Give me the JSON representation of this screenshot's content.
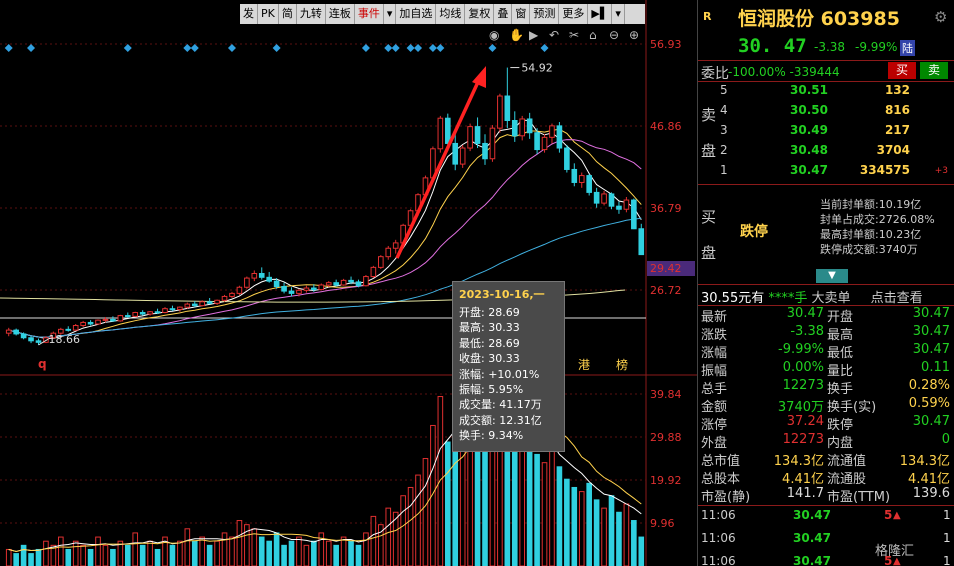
{
  "toolbar": {
    "items": [
      "发",
      "PK",
      "简",
      "九转",
      "连板",
      "事件",
      "▾",
      "加自选",
      "均线",
      "复权",
      "叠",
      "窗",
      "预测",
      "更多",
      "▶▌",
      "▾"
    ]
  },
  "chart": {
    "y_labels": [
      "56.93",
      "46.86",
      "36.79",
      "29.42",
      "26.72"
    ],
    "vol_labels": [
      "39.84",
      "29.88",
      "19.92",
      "9.96"
    ],
    "peak_label": "54.92",
    "low_label": "18.66",
    "marker_q": "q",
    "marker_gang": "港",
    "marker_bang": "榜",
    "colors": {
      "up": "#e03030",
      "down": "#30d0e0",
      "ma5": "#ffffff",
      "ma10": "#ffd24d",
      "ma20": "#e070e0",
      "ma60": "#40b0e0",
      "diamond": "#30a0e0"
    }
  },
  "chart_data": {
    "type": "candlestick",
    "yrange": [
      18,
      58
    ],
    "volume_range": [
      0,
      45
    ],
    "candles": [
      [
        20.2,
        20.9,
        19.8,
        20.6
      ],
      [
        20.6,
        20.8,
        19.9,
        20.1
      ],
      [
        20.1,
        20.3,
        19.4,
        19.6
      ],
      [
        19.6,
        19.8,
        18.9,
        19.2
      ],
      [
        19.2,
        19.5,
        18.66,
        19.0
      ],
      [
        19.0,
        19.8,
        18.9,
        19.6
      ],
      [
        19.6,
        20.4,
        19.5,
        20.2
      ],
      [
        20.2,
        20.9,
        20.0,
        20.7
      ],
      [
        20.7,
        21.1,
        20.4,
        20.6
      ],
      [
        20.6,
        21.4,
        20.5,
        21.2
      ],
      [
        21.2,
        21.8,
        21.0,
        21.6
      ],
      [
        21.6,
        21.9,
        21.2,
        21.4
      ],
      [
        21.4,
        22.0,
        21.3,
        21.9
      ],
      [
        21.9,
        22.3,
        21.6,
        22.0
      ],
      [
        22.0,
        22.4,
        21.7,
        21.8
      ],
      [
        21.8,
        22.6,
        21.7,
        22.5
      ],
      [
        22.5,
        22.9,
        22.2,
        22.4
      ],
      [
        22.4,
        23.0,
        22.3,
        22.9
      ],
      [
        22.9,
        23.2,
        22.5,
        22.7
      ],
      [
        22.7,
        23.1,
        22.5,
        23.0
      ],
      [
        23.0,
        23.4,
        22.7,
        22.9
      ],
      [
        22.9,
        23.6,
        22.8,
        23.4
      ],
      [
        23.4,
        23.8,
        23.1,
        23.3
      ],
      [
        23.3,
        23.7,
        23.0,
        23.6
      ],
      [
        23.6,
        24.2,
        23.4,
        24.0
      ],
      [
        24.0,
        24.4,
        23.6,
        23.8
      ],
      [
        23.8,
        24.5,
        23.7,
        24.3
      ],
      [
        24.3,
        24.8,
        24.0,
        24.1
      ],
      [
        24.1,
        24.6,
        23.9,
        24.5
      ],
      [
        24.5,
        25.2,
        24.3,
        25.0
      ],
      [
        25.0,
        25.6,
        24.8,
        25.4
      ],
      [
        25.4,
        26.4,
        25.2,
        26.2
      ],
      [
        26.2,
        27.6,
        26.0,
        27.4
      ],
      [
        27.4,
        28.4,
        27.0,
        28.0
      ],
      [
        28.0,
        28.8,
        27.2,
        27.5
      ],
      [
        27.5,
        28.2,
        26.8,
        27.0
      ],
      [
        27.0,
        27.4,
        26.0,
        26.3
      ],
      [
        26.3,
        26.8,
        25.4,
        25.7
      ],
      [
        25.7,
        26.2,
        25.0,
        25.4
      ],
      [
        25.4,
        26.0,
        25.0,
        25.8
      ],
      [
        25.8,
        26.4,
        25.5,
        26.1
      ],
      [
        26.1,
        26.6,
        25.6,
        25.9
      ],
      [
        25.9,
        26.7,
        25.8,
        26.5
      ],
      [
        26.5,
        27.0,
        26.2,
        26.8
      ],
      [
        26.8,
        27.2,
        26.3,
        26.5
      ],
      [
        26.5,
        27.3,
        26.4,
        27.1
      ],
      [
        27.1,
        27.6,
        26.6,
        26.9
      ],
      [
        26.9,
        27.2,
        26.2,
        26.4
      ],
      [
        26.4,
        27.8,
        26.3,
        27.6
      ],
      [
        27.6,
        29.0,
        27.4,
        28.8
      ],
      [
        28.8,
        30.4,
        28.6,
        30.2
      ],
      [
        30.2,
        31.6,
        29.8,
        31.3
      ],
      [
        31.3,
        32.4,
        30.6,
        32.0
      ],
      [
        32.0,
        34.5,
        31.8,
        34.3
      ],
      [
        34.3,
        36.4,
        34.0,
        36.2
      ],
      [
        36.2,
        38.5,
        35.5,
        38.3
      ],
      [
        38.3,
        40.8,
        37.8,
        40.5
      ],
      [
        40.5,
        44.6,
        40.0,
        44.3
      ],
      [
        44.3,
        48.6,
        43.8,
        48.3
      ],
      [
        48.3,
        48.9,
        44.0,
        45.0
      ],
      [
        45.0,
        46.6,
        41.5,
        42.3
      ],
      [
        42.3,
        44.8,
        41.8,
        44.4
      ],
      [
        44.4,
        47.6,
        44.0,
        47.2
      ],
      [
        47.2,
        48.4,
        44.4,
        45.0
      ],
      [
        45.0,
        46.2,
        42.2,
        43.0
      ],
      [
        43.0,
        47.4,
        42.6,
        47.0
      ],
      [
        47.0,
        51.5,
        46.4,
        51.2
      ],
      [
        51.2,
        54.92,
        47.0,
        48.0
      ],
      [
        48.0,
        49.2,
        45.2,
        46.0
      ],
      [
        46.0,
        48.6,
        45.4,
        48.2
      ],
      [
        48.2,
        49.0,
        45.6,
        46.4
      ],
      [
        46.4,
        47.0,
        43.6,
        44.2
      ],
      [
        44.2,
        46.2,
        43.8,
        45.8
      ],
      [
        45.8,
        47.6,
        45.0,
        47.3
      ],
      [
        47.3,
        47.8,
        43.8,
        44.4
      ],
      [
        44.4,
        44.8,
        41.2,
        41.6
      ],
      [
        41.6,
        42.4,
        39.4,
        39.9
      ],
      [
        39.9,
        41.2,
        39.2,
        40.8
      ],
      [
        40.8,
        41.0,
        38.2,
        38.6
      ],
      [
        38.6,
        39.2,
        36.6,
        37.2
      ],
      [
        37.2,
        38.8,
        36.9,
        38.4
      ],
      [
        38.4,
        38.6,
        36.4,
        36.8
      ],
      [
        36.8,
        37.4,
        35.8,
        36.4
      ],
      [
        36.4,
        38.0,
        36.0,
        37.6
      ],
      [
        37.6,
        37.8,
        33.8,
        33.85
      ],
      [
        33.85,
        34.5,
        30.47,
        30.47
      ]
    ],
    "volumes": [
      4,
      3,
      5,
      3,
      4,
      6,
      5,
      7,
      4,
      6,
      5,
      4,
      7,
      5,
      4,
      6,
      5,
      8,
      5,
      6,
      4,
      7,
      5,
      6,
      9,
      6,
      7,
      5,
      6,
      8,
      7,
      11,
      10,
      9,
      7,
      6,
      8,
      5,
      6,
      7,
      5,
      6,
      8,
      6,
      5,
      7,
      6,
      5,
      8,
      12,
      10,
      14,
      13,
      17,
      19,
      22,
      26,
      34,
      41,
      30,
      33,
      29,
      37,
      31,
      28,
      35,
      40,
      44,
      33,
      38,
      29,
      27,
      25,
      30,
      24,
      21,
      19,
      18,
      20,
      16,
      14,
      17,
      13,
      15,
      11,
      7
    ],
    "tooltip_index": 50
  },
  "tooltip": {
    "date": "2023-10-16,一",
    "rows": [
      "开盘: 28.69",
      "最高: 30.33",
      "最低: 28.69",
      "收盘: 30.33",
      "涨幅: +10.01%",
      "振幅: 5.95%",
      "成交量: 41.17万",
      "成交额: 12.31亿",
      "换手: 9.34%"
    ]
  },
  "panel": {
    "r_tag": "R",
    "name": "恒润股份 603985",
    "price": "30. 47",
    "change": "-3.38",
    "change_pct": "-9.99%",
    "tag": "陆",
    "weibi_label": "委比",
    "weibi_value": "-100.00%  -339444",
    "buy_label": "买",
    "sell_label": "卖",
    "ask_side": [
      "卖",
      "盘"
    ],
    "asks": [
      {
        "lvl": "5",
        "px": "30.51",
        "vol": "132",
        "ext": ""
      },
      {
        "lvl": "4",
        "px": "30.50",
        "vol": "816",
        "ext": ""
      },
      {
        "lvl": "3",
        "px": "30.49",
        "vol": "217",
        "ext": ""
      },
      {
        "lvl": "2",
        "px": "30.48",
        "vol": "3704",
        "ext": ""
      },
      {
        "lvl": "1",
        "px": "30.47",
        "vol": "334575",
        "ext": "+3"
      }
    ],
    "bid_side": [
      "买",
      "盘"
    ],
    "limit_text": "跌停",
    "seal": [
      {
        "k": "当前封单额:",
        "v": "10.19亿"
      },
      {
        "k": "封单占成交:",
        "v": "2726.08%"
      },
      {
        "k": "最高封单额:",
        "v": "10.23亿"
      },
      {
        "k": "跌停成交额:",
        "v": "3740万"
      }
    ],
    "big_bar": {
      "a": "30.55元有",
      "b": "****手",
      "c": "大卖单",
      "d": "点击查看"
    },
    "quote": [
      {
        "k1": "最新",
        "v1": "30.47",
        "c1": "green",
        "k2": "开盘",
        "v2": "30.47",
        "c2": "green"
      },
      {
        "k1": "涨跌",
        "v1": "-3.38",
        "c1": "green",
        "k2": "最高",
        "v2": "30.47",
        "c2": "green"
      },
      {
        "k1": "涨幅",
        "v1": "-9.99%",
        "c1": "green",
        "k2": "最低",
        "v2": "30.47",
        "c2": "green"
      },
      {
        "k1": "振幅",
        "v1": "0.00%",
        "c1": "green",
        "k2": "量比",
        "v2": "0.11",
        "c2": "green"
      },
      {
        "k1": "总手",
        "v1": "12273",
        "c1": "green",
        "k2": "换手",
        "v2": "0.28%",
        "c2": "yellow"
      },
      {
        "k1": "金额",
        "v1": "3740万",
        "c1": "green",
        "k2": "换手(实)",
        "v2": "0.59%",
        "c2": "yellow"
      },
      {
        "k1": "涨停",
        "v1": "37.24",
        "c1": "red",
        "k2": "跌停",
        "v2": "30.47",
        "c2": "green"
      },
      {
        "k1": "外盘",
        "v1": "12273",
        "c1": "red",
        "k2": "内盘",
        "v2": "0",
        "c2": "green"
      },
      {
        "k1": "总市值",
        "v1": "134.3亿",
        "c1": "yellow",
        "k2": "流通值",
        "v2": "134.3亿",
        "c2": "yellow"
      },
      {
        "k1": "总股本",
        "v1": "4.41亿",
        "c1": "yellow",
        "k2": "流通股",
        "v2": "4.41亿",
        "c2": "yellow"
      },
      {
        "k1": "市盈(静)",
        "v1": "141.7",
        "c1": "white",
        "k2": "市盈(TTM)",
        "v2": "139.6",
        "c2": "white"
      }
    ],
    "ticks": [
      {
        "t": "11:06",
        "p": "30.47",
        "v": "5",
        "n": "1"
      },
      {
        "t": "11:06",
        "p": "30.47",
        "v": "",
        "n": "1"
      },
      {
        "t": "11:06",
        "p": "30.47",
        "v": "5",
        "n": "1"
      }
    ],
    "watermark": "格隆汇"
  }
}
